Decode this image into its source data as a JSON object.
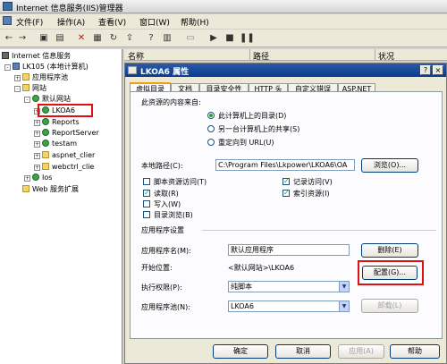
{
  "window": {
    "title": "Internet 信息服务(IIS)管理器"
  },
  "menu": [
    "文件(F)",
    "操作(A)",
    "查看(V)",
    "窗口(W)",
    "帮助(H)"
  ],
  "toolbar_icons": [
    "back-icon",
    "forward-icon",
    "folder-up-icon",
    "console-tree-icon",
    "delete-icon",
    "properties-icon",
    "refresh-icon",
    "export-icon",
    "help-icon",
    "view-icon",
    "start-icon",
    "stop-icon",
    "pause-icon"
  ],
  "tree": {
    "items": [
      {
        "label": "Internet 信息服务",
        "level": 0,
        "icon": "iis-icon",
        "expander": ""
      },
      {
        "label": "LK105 (本地计算机)",
        "level": 1,
        "icon": "computer-icon",
        "expander": "-"
      },
      {
        "label": "应用程序池",
        "level": 2,
        "icon": "folder-icon",
        "expander": "+"
      },
      {
        "label": "网站",
        "level": 2,
        "icon": "folder-icon",
        "expander": "-"
      },
      {
        "label": "默认网站",
        "level": 3,
        "icon": "globe-icon",
        "expander": "-"
      },
      {
        "label": "LKOA6",
        "level": 4,
        "icon": "globe-icon",
        "expander": "+"
      },
      {
        "label": "Reports",
        "level": 4,
        "icon": "globe-icon",
        "expander": "+"
      },
      {
        "label": "ReportServer",
        "level": 4,
        "icon": "globe-icon",
        "expander": "+"
      },
      {
        "label": "testam",
        "level": 4,
        "icon": "globe-icon",
        "expander": "+"
      },
      {
        "label": "aspnet_clier",
        "level": 4,
        "icon": "folder-icon",
        "expander": "+"
      },
      {
        "label": "webctrl_clie",
        "level": 4,
        "icon": "folder-icon",
        "expander": "+"
      },
      {
        "label": "Ios",
        "level": 3,
        "icon": "globe-icon",
        "expander": "+"
      },
      {
        "label": "Web 服务扩展",
        "level": 2,
        "icon": "folder-icon",
        "expander": ""
      }
    ]
  },
  "list": {
    "columns": [
      "名称",
      "路径",
      "状况"
    ]
  },
  "dialog": {
    "title": "LKOA6 属性",
    "title_buttons": [
      "?",
      "×"
    ],
    "tabs": [
      "虚拟目录",
      "文档",
      "目录安全性",
      "HTTP 头",
      "自定义错误",
      "ASP.NET"
    ],
    "source_label": "此资源的内容来自:",
    "source_options": [
      "此计算机上的目录(D)",
      "另一台计算机上的共享(S)",
      "重定向到 URL(U)"
    ],
    "local_path_label": "本地路径(C):",
    "local_path_value": "C:\\Program Files\\Lkpower\\LKOA6\\OA",
    "browse_button": "浏览(O)...",
    "checkboxes_left": [
      {
        "label": "脚本资源访问(T)",
        "checked": false
      },
      {
        "label": "读取(R)",
        "checked": true
      },
      {
        "label": "写入(W)",
        "checked": false
      },
      {
        "label": "目录浏览(B)",
        "checked": false
      }
    ],
    "checkboxes_right": [
      {
        "label": "记录访问(V)",
        "checked": true
      },
      {
        "label": "索引资源(I)",
        "checked": true
      }
    ],
    "app_settings_label": "应用程序设置",
    "app_name_label": "应用程序名(M):",
    "app_name_value": "默认应用程序",
    "remove_button": "删除(E)",
    "start_point_label": "开始位置:",
    "start_point_value": "<默认网站>\\LKOA6",
    "config_button": "配置(G)...",
    "exec_perm_label": "执行权限(P):",
    "exec_perm_value": "纯脚本",
    "app_pool_label": "应用程序池(N):",
    "app_pool_value": "LKOA6",
    "unload_button": "卸载(L)",
    "footer_buttons": [
      "确定",
      "取消",
      "应用(A)",
      "帮助"
    ],
    "highlight_color": "#e01010"
  }
}
